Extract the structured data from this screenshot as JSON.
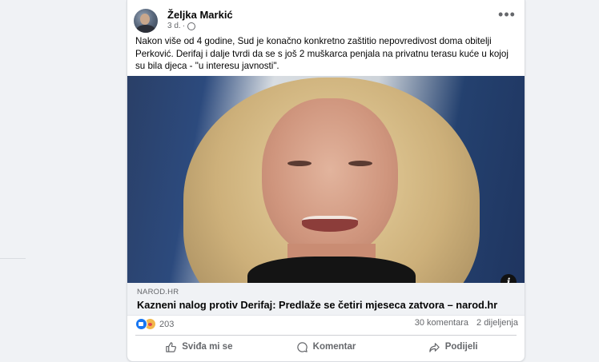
{
  "post": {
    "author": "Željka Markić",
    "time": "3 d.",
    "text": "Nakon više od 4 godine, Sud je konačno konkretno zaštitio nepovredivost doma obitelji Perković. Derifaj i dalje tvrdi da se s još 2 muškarca penjala na privatnu terasu kuće u kojoj su bila djeca - \"u interesu javnosti\".",
    "more_label": "•••",
    "info_label": "i",
    "link": {
      "domain": "NAROD.HR",
      "title": "Kazneni nalog protiv Derifaj: Predlaže se četiri mjeseca zatvora – narod.hr"
    },
    "stats": {
      "reaction_count": "203",
      "comments": "30 komentara",
      "shares": "2 dijeljenja"
    },
    "actions": {
      "like": "Sviđa mi se",
      "comment": "Komentar",
      "share": "Podijeli"
    }
  }
}
